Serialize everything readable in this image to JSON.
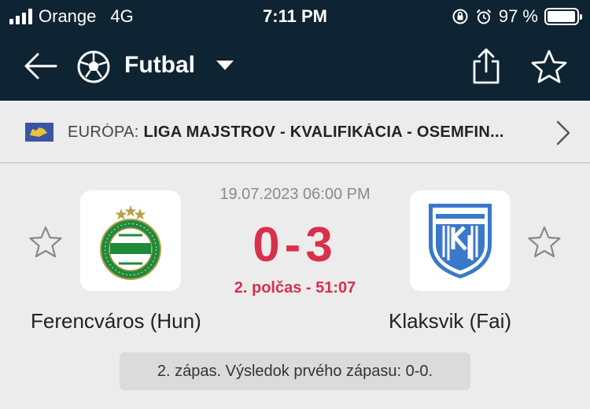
{
  "status_bar": {
    "carrier": "Orange",
    "network": "4G",
    "time": "7:11 PM",
    "battery": "97 %",
    "battery_level": 0.97,
    "icons": [
      "signal-icon",
      "orientation-lock-icon",
      "alarm-icon",
      "battery-icon"
    ]
  },
  "nav": {
    "title": "Futbal",
    "icons": [
      "back-arrow-icon",
      "soccer-ball-icon",
      "dropdown-caret-icon",
      "share-icon",
      "favorite-star-icon"
    ]
  },
  "league": {
    "region": "EURÓPA: ",
    "name": "LIGA MAJSTROV - KVALIFIKÁCIA - OSEMFIN...",
    "icons": [
      "europe-flag-icon",
      "chevron-right-icon"
    ]
  },
  "match": {
    "datetime": "19.07.2023 06:00 PM",
    "score": "0-3",
    "period": "2. polčas - 51:07",
    "home": {
      "name": "Ferencváros (Hun)",
      "logo_icon": "ferencvaros-crest-icon"
    },
    "away": {
      "name": "Klaksvik (Fai)",
      "logo_icon": "klaksvik-crest-icon"
    },
    "note": "2. zápas. Výsledok prvého zápasu: 0-0."
  },
  "colors": {
    "header_bg": "#0e2432",
    "page_bg": "#ececec",
    "score_red": "#d8304b",
    "ferencvaros_green": "#1f8a3a",
    "klaksvik_blue": "#3a78c9"
  }
}
